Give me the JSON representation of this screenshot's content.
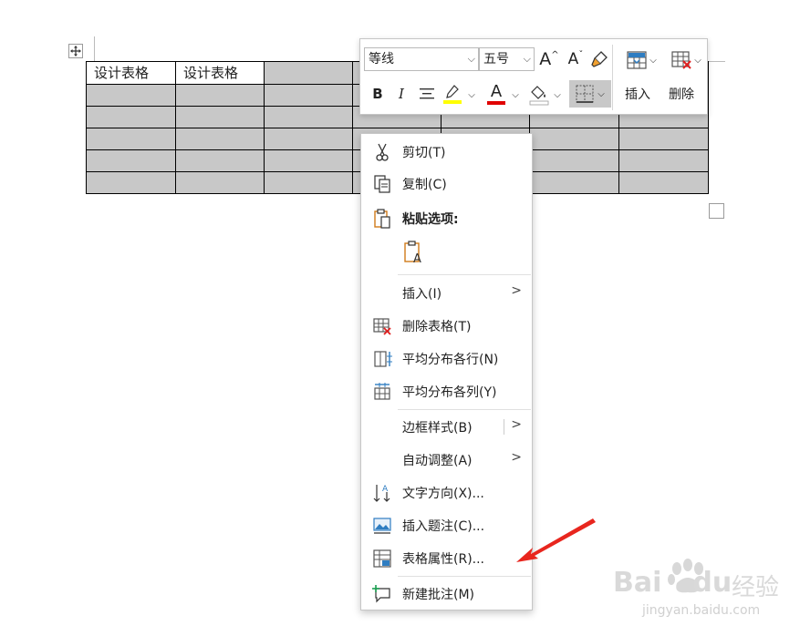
{
  "table": {
    "rows": [
      [
        "设计表格",
        "设计表格",
        "",
        "",
        "",
        "",
        ""
      ],
      [
        "",
        "",
        "",
        "",
        "",
        "",
        ""
      ],
      [
        "",
        "",
        "",
        "",
        "",
        "",
        ""
      ],
      [
        "",
        "",
        "",
        "",
        "",
        "",
        ""
      ],
      [
        "",
        "",
        "",
        "",
        "",
        "",
        ""
      ],
      [
        "",
        "",
        "",
        "",
        "",
        "",
        ""
      ]
    ]
  },
  "toolbar": {
    "font_name": "等线",
    "font_size": "五号",
    "insert_label": "插入",
    "delete_label": "删除",
    "bold_label": "B",
    "italic_label": "I",
    "grow_label": "A",
    "shrink_label": "A",
    "font_color_label": "A",
    "highlight_color": "#ffff00",
    "font_color": "#e00000"
  },
  "context_menu": {
    "cut": "剪切(T)",
    "copy": "复制(C)",
    "paste_options": "粘贴选项:",
    "insert": "插入(I)",
    "delete_table": "删除表格(T)",
    "distribute_rows": "平均分布各行(N)",
    "distribute_columns": "平均分布各列(Y)",
    "border_styles": "边框样式(B)",
    "autofit": "自动调整(A)",
    "text_direction": "文字方向(X)...",
    "insert_caption": "插入题注(C)...",
    "table_properties": "表格属性(R)...",
    "new_comment": "新建批注(M)"
  },
  "watermark": {
    "brand": "Bai",
    "brand2": "du",
    "product": "经验",
    "url": "jingyan.baidu.com"
  },
  "colors": {
    "accent_arrow": "#e8261e",
    "cell_fill": "#c8c8c8"
  }
}
